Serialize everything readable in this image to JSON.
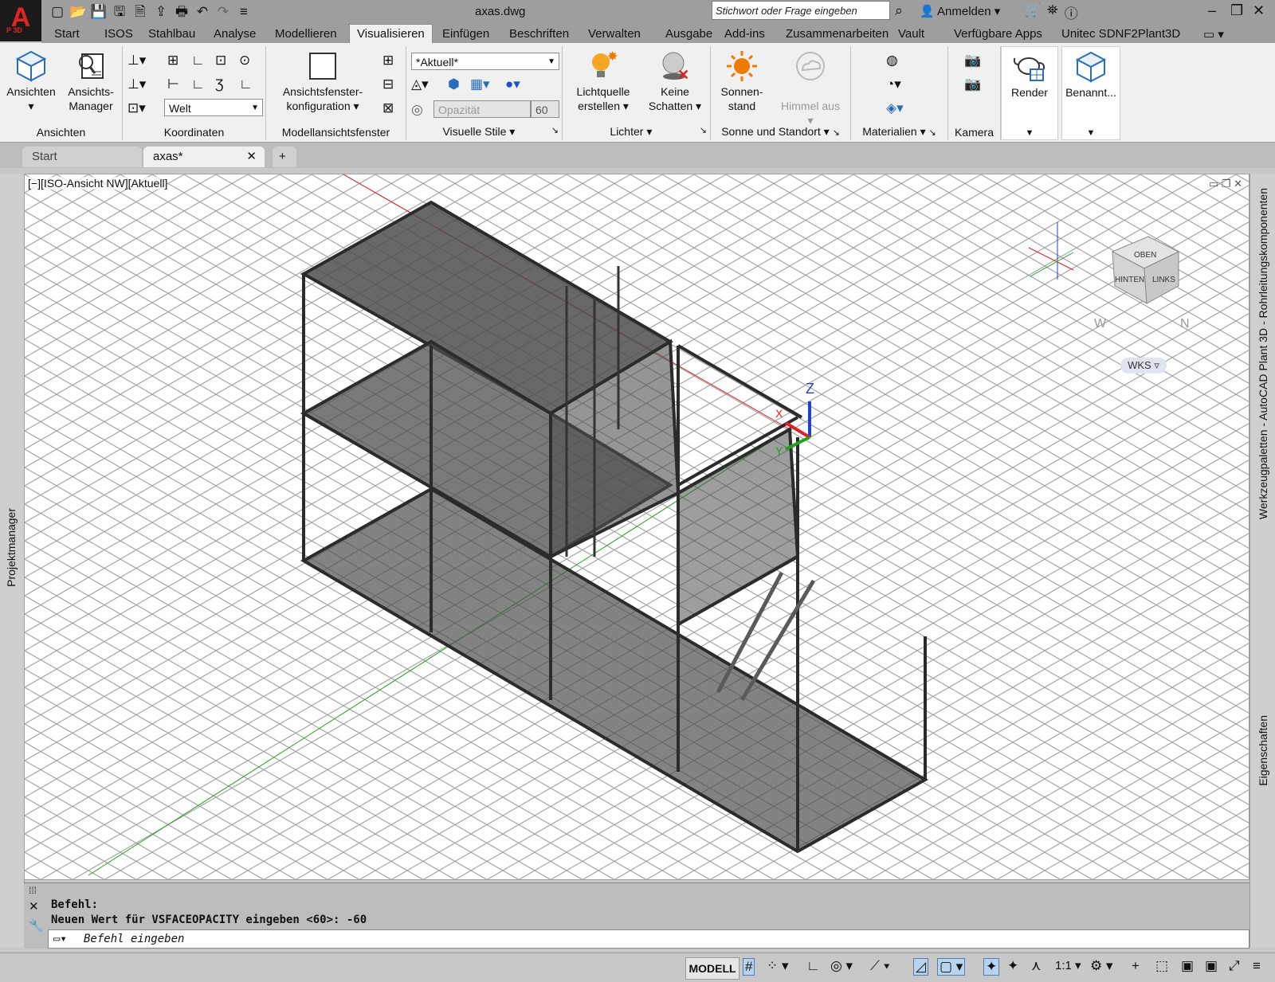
{
  "app": {
    "logo": "A",
    "logo_sub": "P 3D",
    "title": "axas.dwg"
  },
  "quick_access": {
    "icons": [
      "new-icon",
      "open-icon",
      "save-icon",
      "save-as-icon",
      "publish-icon",
      "import-icon",
      "print-icon",
      "undo-icon",
      "redo-icon",
      "customize-icon"
    ]
  },
  "search": {
    "placeholder": "Stichwort oder Frage eingeben"
  },
  "signin": {
    "label": "Anmelden"
  },
  "menu": {
    "tabs": [
      "Start",
      "ISOS",
      "Stahlbau",
      "Analyse",
      "Modellieren",
      "Visualisieren",
      "Einfügen",
      "Beschriften",
      "Verwalten",
      "Ausgabe",
      "Add-ins",
      "Zusammenarbeiten",
      "Vault",
      "Verfügbare Apps",
      "Unitec SDNF2Plant3D"
    ],
    "active": "Visualisieren"
  },
  "ribbon": {
    "ansichten": {
      "label": "Ansichten",
      "btn1": "Ansichten",
      "btn2_line1": "Ansichts-",
      "btn2_line2": "Manager"
    },
    "koordinaten": {
      "label": "Koordinaten",
      "ucs_value": "Welt"
    },
    "modellansicht": {
      "label": "Modellansichtsfenster",
      "btn_line1": "Ansichtsfenster-",
      "btn_line2": "konfiguration"
    },
    "visuelle_stile": {
      "label": "Visuelle Stile",
      "style_value": "*Aktuell*",
      "opacity_label": "Opazität",
      "opacity_value": "60"
    },
    "lichter": {
      "label": "Lichter",
      "btn1_line1": "Lichtquelle",
      "btn1_line2": "erstellen",
      "btn2_line1": "Keine",
      "btn2_line2": "Schatten"
    },
    "sonne": {
      "label": "Sonne und Standort",
      "btn1_line1": "Sonnen-",
      "btn1_line2": "stand",
      "btn2": "Himmel aus"
    },
    "materialien": {
      "label": "Materialien"
    },
    "kamera": {
      "label": "Kamera"
    },
    "render": {
      "label": "Render"
    },
    "benannt": {
      "label": "Benannt..."
    }
  },
  "doc_tabs": {
    "start": "Start",
    "active": "axas*",
    "add": "+"
  },
  "viewport": {
    "label": "[−][ISO-Ansicht NW][Aktuell]",
    "viewcube_top": "OBEN",
    "viewcube_left": "HINTEN",
    "viewcube_right": "LINKS",
    "wcs_label": "WKS",
    "axis_z": "Z",
    "axis_x": "X",
    "axis_y": "Y",
    "compass_w": "W",
    "compass_n": "N"
  },
  "palettes": {
    "left": "Projektmanager",
    "right_top": "Werkzeugpaletten - AutoCAD Plant 3D - Rohrleitungskomponenten",
    "right_bottom": "Eigenschaften"
  },
  "command": {
    "line1": "Befehl:",
    "line2": "Neuen Wert für VSFACEOPACITY eingeben <60>: -60",
    "placeholder": "Befehl eingeben"
  },
  "status": {
    "model": "MODELL",
    "scale": "1:1"
  },
  "colors": {
    "accent": "#2a6ebb",
    "grid": "#9a9a9a",
    "structure": "#4e4e4e",
    "x_axis": "#e02020",
    "y_axis": "#20a020",
    "z_axis": "#2040d0"
  }
}
